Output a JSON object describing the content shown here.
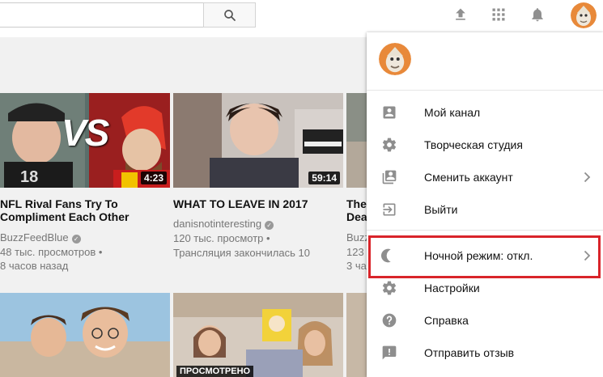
{
  "topbar": {
    "search_value": "",
    "icons": [
      "search-icon",
      "upload-icon",
      "apps-icon",
      "notifications-icon",
      "avatar"
    ]
  },
  "videos": [
    {
      "title": "NFL Rival Fans Try To Compliment Each Other",
      "channel": "BuzzFeedBlue",
      "views": "48 тыс. просмотров •",
      "age": "8 часов назад",
      "duration": "4:23",
      "overlay_text": "VS"
    },
    {
      "title": "WHAT TO LEAVE IN 2017",
      "channel": "danisnotinteresting",
      "views": "120 тыс. просмотр •",
      "age": "Трансляция закончилась 10",
      "duration": "59:14"
    },
    {
      "title_line1": "The",
      "title_line2": "Dea",
      "channel": "Buzz",
      "views": "123",
      "age": "3 ча"
    }
  ],
  "second_row": {
    "badge_text": "ПРОСМОТРЕНО"
  },
  "account_menu": {
    "items": [
      {
        "label": "Мой канал",
        "icon": "account-box-icon"
      },
      {
        "label": "Творческая студия",
        "icon": "gear-icon"
      },
      {
        "label": "Сменить аккаунт",
        "icon": "switch-account-icon",
        "has_submenu": true
      },
      {
        "label": "Выйти",
        "icon": "sign-out-icon"
      },
      {
        "label": "Ночной режим: откл.",
        "icon": "moon-icon",
        "has_submenu": true,
        "highlighted": true
      },
      {
        "label": "Настройки",
        "icon": "gear-icon"
      },
      {
        "label": "Справка",
        "icon": "help-icon"
      },
      {
        "label": "Отправить отзыв",
        "icon": "feedback-icon"
      }
    ]
  },
  "colors": {
    "highlight_border": "#d9242a",
    "icon_gray": "#8e8e8e",
    "text_meta": "#767676",
    "page_bg": "#f1f1f1"
  }
}
